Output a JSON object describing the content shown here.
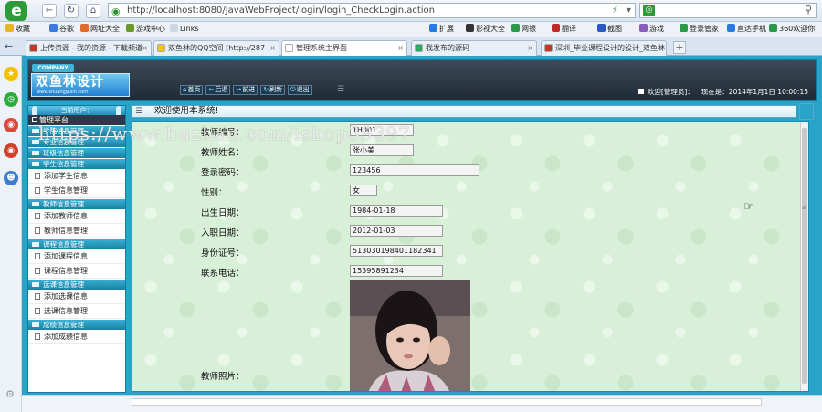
{
  "browser": {
    "logo": "e",
    "address": "http://localhost:8080/JavaWebProject/login/login_CheckLogin.action",
    "search_logo": "◎",
    "favorites": [
      {
        "label": "收藏",
        "color": "#e9b32a"
      },
      {
        "label": "谷歌",
        "color": "#3b7be0"
      },
      {
        "label": "网址大全",
        "color": "#e06a2a"
      },
      {
        "label": "游戏中心",
        "color": "#6a9a2a"
      },
      {
        "label": "Links",
        "color": "#cdd8e4"
      }
    ],
    "tools": [
      {
        "label": "扩展",
        "color": "#2a7be0"
      },
      {
        "label": "影视大全",
        "color": "#333333"
      },
      {
        "label": "网银",
        "color": "#2a9a4a"
      },
      {
        "label": "翻译",
        "color": "#c02a2a"
      },
      {
        "label": "截图",
        "color": "#2a5ac0"
      },
      {
        "label": "游戏",
        "color": "#8a5ac0"
      },
      {
        "label": "登录管家",
        "color": "#2a9a4a"
      },
      {
        "label": "直达手机",
        "color": "#2a7be0"
      },
      {
        "label": "360欢迎你",
        "color": "#2a9a4a"
      }
    ],
    "tabs": [
      {
        "label": "上传资源 - 我的资源 - 下载频道",
        "color": "#c0392b",
        "active": false
      },
      {
        "label": "双鱼林的QQ空间 [http://287",
        "color": "#f1c40f",
        "active": false
      },
      {
        "label": "管理系统主界面",
        "color": "#ffffff",
        "active": true
      },
      {
        "label": "我发布的源码",
        "color": "#27ae60",
        "active": false
      },
      {
        "label": "深圳_毕业课程设计的设计_双鱼林",
        "color": "#c0392b",
        "active": false
      }
    ]
  },
  "header": {
    "company": "COMPANY",
    "brand": "双鱼林设计",
    "brand_url": "www.shuangyulin.com",
    "buttons": [
      {
        "icon": "⌂",
        "label": "首页"
      },
      {
        "icon": "←",
        "label": "后退"
      },
      {
        "icon": "→",
        "label": "前进"
      },
      {
        "icon": "↻",
        "label": "刷新"
      },
      {
        "icon": "⏻",
        "label": "退出"
      }
    ],
    "welcome": "欢迎[管理员]：",
    "time": "现在是：2014年1月1日 10:00:15"
  },
  "sidebar": {
    "current_user": "当前用户：",
    "system": "管理平台",
    "cats": [
      {
        "label": "学院信息管理",
        "subs": []
      },
      {
        "label": "专业信息管理",
        "subs": []
      },
      {
        "label": "班级信息管理",
        "subs": []
      },
      {
        "label": "学生信息管理",
        "subs": [
          "添加学生信息",
          "学生信息管理"
        ]
      },
      {
        "label": "教师信息管理",
        "subs": [
          "添加教师信息",
          "教师信息管理"
        ]
      },
      {
        "label": "课程信息管理",
        "subs": [
          "添加课程信息",
          "课程信息管理"
        ]
      },
      {
        "label": "选课信息管理",
        "subs": [
          "添加选课信息",
          "选课信息管理"
        ]
      },
      {
        "label": "成绩信息管理",
        "subs": [
          "添加成绩信息"
        ]
      }
    ]
  },
  "main": {
    "welcome": "欢迎使用本系统!",
    "fields": [
      {
        "label": "教师编号：",
        "value": "TH001"
      },
      {
        "label": "教师姓名：",
        "value": "张小美"
      },
      {
        "label": "登录密码：",
        "value": "123456"
      },
      {
        "label": "性别：",
        "value": "女"
      },
      {
        "label": "出生日期：",
        "value": "1984-01-18"
      },
      {
        "label": "入职日期：",
        "value": "2012-01-03"
      },
      {
        "label": "身份证号：",
        "value": "513030198401182341"
      },
      {
        "label": "联系电话：",
        "value": "15395891234"
      }
    ],
    "photo_label": "教师照片："
  },
  "watermark": "https://www.huzhan.com/ishop39397"
}
